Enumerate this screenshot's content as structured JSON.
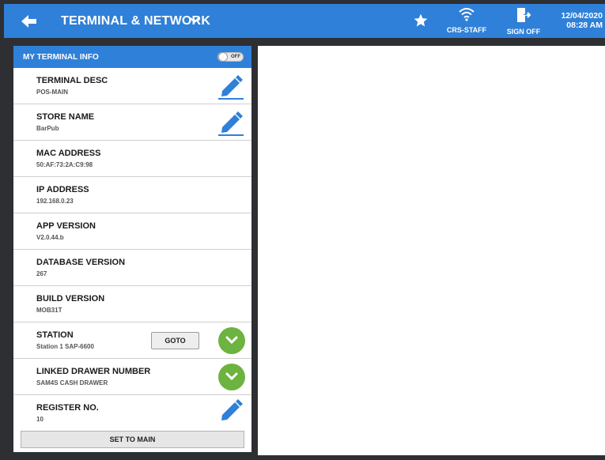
{
  "header": {
    "title": "TERMINAL & NETWORK",
    "user_label": "CRS-STAFF",
    "sign_off_label": "SIGN OFF",
    "date": "12/04/2020",
    "time": "08:28 AM",
    "color": "#2f80d8"
  },
  "panel": {
    "title": "MY TERMINAL INFO",
    "toggle_state": "OFF",
    "rows": [
      {
        "label": "TERMINAL DESC",
        "value": "POS-MAIN"
      },
      {
        "label": "STORE NAME",
        "value": "BarPub"
      },
      {
        "label": "MAC ADDRESS",
        "value": "50:AF:73:2A:C9:98"
      },
      {
        "label": "IP ADDRESS",
        "value": "192.168.0.23"
      },
      {
        "label": "APP VERSION",
        "value": "V2.0.44.b"
      },
      {
        "label": "DATABASE VERSION",
        "value": "267"
      },
      {
        "label": "BUILD VERSION",
        "value": "MOB31T"
      },
      {
        "label": "STATION",
        "value": "Station 1 SAP-6600",
        "button": "GOTO"
      },
      {
        "label": "LINKED DRAWER NUMBER",
        "value": "SAM4S CASH DRAWER"
      },
      {
        "label": "REGISTER NO.",
        "value": "10"
      }
    ],
    "set_to_main_label": "SET TO MAIN"
  },
  "icons": {
    "back": "arrow-left-icon",
    "dropdown": "chevron-down-icon",
    "favorite": "star-icon",
    "network": "wifi-icon",
    "sign_off": "exit-door-icon",
    "edit": "pencil-icon",
    "expand": "check-chevron-icon"
  },
  "colors": {
    "accent": "#2f80d8",
    "success": "#6cb33f"
  }
}
